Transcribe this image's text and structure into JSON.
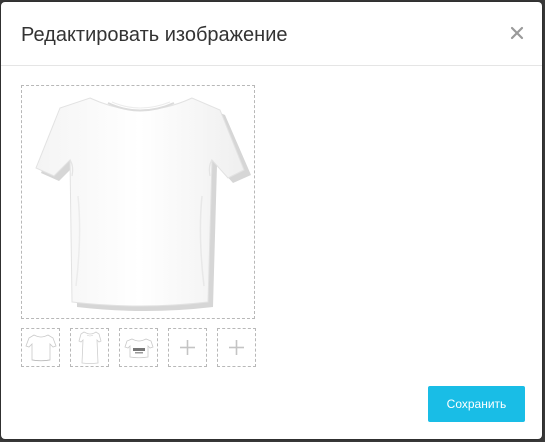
{
  "modal": {
    "title": "Редактировать изображение",
    "close_icon": "close-icon"
  },
  "images": {
    "main": {
      "icon": "tshirt-front-image"
    },
    "thumbnails": [
      {
        "icon": "tshirt-front-thumbnail"
      },
      {
        "icon": "long-tshirt-thumbnail"
      },
      {
        "icon": "crop-top-thumbnail"
      },
      {
        "icon": "add-image-icon"
      },
      {
        "icon": "add-image-icon"
      }
    ]
  },
  "footer": {
    "save_label": "Сохранить"
  },
  "colors": {
    "accent": "#19bde6",
    "title": "#333333",
    "border_dashed": "#b8b8b8"
  }
}
